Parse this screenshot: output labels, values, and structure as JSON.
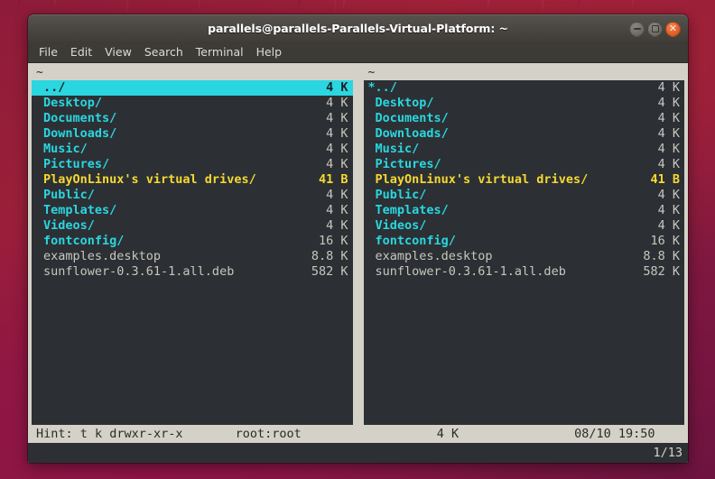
{
  "window": {
    "title": "parallels@parallels-Parallels-Virtual-Platform: ~",
    "controls": {
      "minimize_label": "—",
      "maximize_label": "□",
      "close_label": "✕"
    }
  },
  "menubar": {
    "items": [
      {
        "label": "File"
      },
      {
        "label": "Edit"
      },
      {
        "label": "View"
      },
      {
        "label": "Search"
      },
      {
        "label": "Terminal"
      },
      {
        "label": "Help"
      }
    ]
  },
  "left_pane": {
    "header": "~",
    "rows": [
      {
        "marker": "",
        "name": "../",
        "size": "4 K",
        "type": "dir",
        "selected": true
      },
      {
        "marker": "",
        "name": "Desktop/",
        "size": "4 K",
        "type": "dir",
        "selected": false
      },
      {
        "marker": "",
        "name": "Documents/",
        "size": "4 K",
        "type": "dir",
        "selected": false
      },
      {
        "marker": "",
        "name": "Downloads/",
        "size": "4 K",
        "type": "dir",
        "selected": false
      },
      {
        "marker": "",
        "name": "Music/",
        "size": "4 K",
        "type": "dir",
        "selected": false
      },
      {
        "marker": "",
        "name": "Pictures/",
        "size": "4 K",
        "type": "dir",
        "selected": false
      },
      {
        "marker": "",
        "name": "PlayOnLinux's virtual drives/",
        "size": "41 B",
        "type": "link",
        "selected": false
      },
      {
        "marker": "",
        "name": "Public/",
        "size": "4 K",
        "type": "dir",
        "selected": false
      },
      {
        "marker": "",
        "name": "Templates/",
        "size": "4 K",
        "type": "dir",
        "selected": false
      },
      {
        "marker": "",
        "name": "Videos/",
        "size": "4 K",
        "type": "dir",
        "selected": false
      },
      {
        "marker": "",
        "name": "fontconfig/",
        "size": "16 K",
        "type": "dir",
        "selected": false
      },
      {
        "marker": "",
        "name": "examples.desktop",
        "size": "8.8 K",
        "type": "file",
        "selected": false
      },
      {
        "marker": "",
        "name": "sunflower-0.3.61-1.all.deb",
        "size": "582 K",
        "type": "file",
        "selected": false
      }
    ]
  },
  "right_pane": {
    "header": "~",
    "rows": [
      {
        "marker": "*",
        "name": "../",
        "size": "4 K",
        "type": "dir",
        "selected": false
      },
      {
        "marker": "",
        "name": "Desktop/",
        "size": "4 K",
        "type": "dir",
        "selected": false
      },
      {
        "marker": "",
        "name": "Documents/",
        "size": "4 K",
        "type": "dir",
        "selected": false
      },
      {
        "marker": "",
        "name": "Downloads/",
        "size": "4 K",
        "type": "dir",
        "selected": false
      },
      {
        "marker": "",
        "name": "Music/",
        "size": "4 K",
        "type": "dir",
        "selected": false
      },
      {
        "marker": "",
        "name": "Pictures/",
        "size": "4 K",
        "type": "dir",
        "selected": false
      },
      {
        "marker": "",
        "name": "PlayOnLinux's virtual drives/",
        "size": "41 B",
        "type": "link",
        "selected": false
      },
      {
        "marker": "",
        "name": "Public/",
        "size": "4 K",
        "type": "dir",
        "selected": false
      },
      {
        "marker": "",
        "name": "Templates/",
        "size": "4 K",
        "type": "dir",
        "selected": false
      },
      {
        "marker": "",
        "name": "Videos/",
        "size": "4 K",
        "type": "dir",
        "selected": false
      },
      {
        "marker": "",
        "name": "fontconfig/",
        "size": "16 K",
        "type": "dir",
        "selected": false
      },
      {
        "marker": "",
        "name": "examples.desktop",
        "size": "8.8 K",
        "type": "file",
        "selected": false
      },
      {
        "marker": "",
        "name": "sunflower-0.3.61-1.all.deb",
        "size": "582 K",
        "type": "file",
        "selected": false
      }
    ]
  },
  "statusbar": {
    "hint": "Hint: t k drwxr-xr-x",
    "owner": "root:root",
    "size": "4 K",
    "timestamp": "08/10 19:50"
  },
  "cmdline": {
    "position": "1/13"
  },
  "colors": {
    "directory": "#2ad6e0",
    "symlink": "#f5d932",
    "regular_file": "#c9c6bd",
    "cursor_highlight": "#2ad6e0",
    "pane_background": "#2c3034",
    "terminal_background": "#d4d2c8"
  }
}
